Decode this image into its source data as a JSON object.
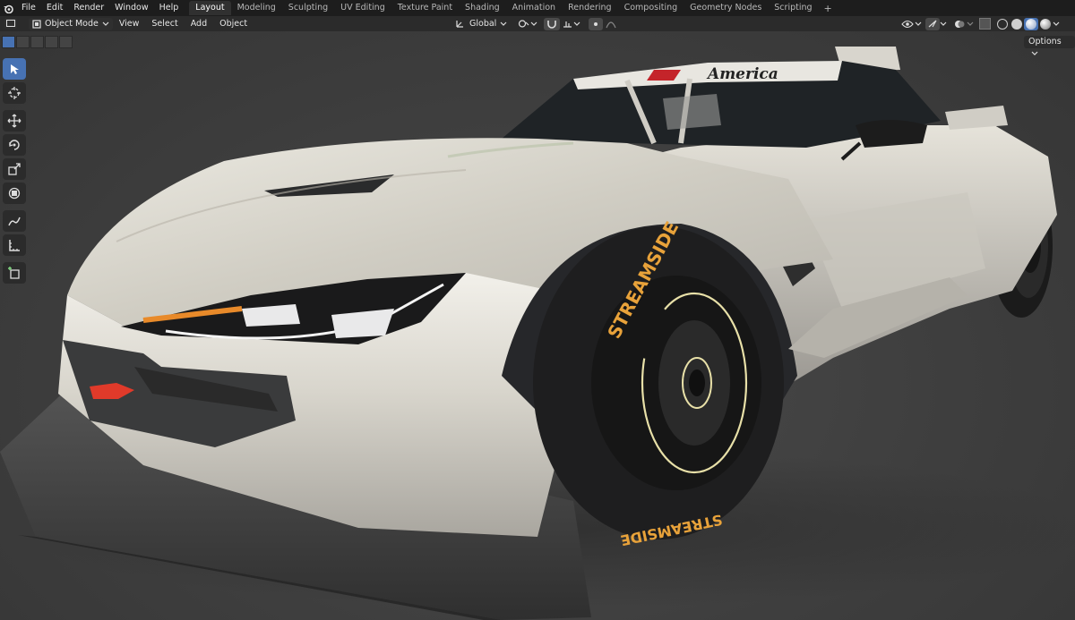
{
  "app": {
    "logo_icon": "blender-logo-icon"
  },
  "menu": [
    "File",
    "Edit",
    "Render",
    "Window",
    "Help"
  ],
  "workspaces": {
    "tabs": [
      "Layout",
      "Modeling",
      "Sculpting",
      "UV Editing",
      "Texture Paint",
      "Shading",
      "Animation",
      "Rendering",
      "Compositing",
      "Geometry Nodes",
      "Scripting"
    ],
    "active": "Layout",
    "add_label": "+"
  },
  "header": {
    "mode": "Object Mode",
    "menus": [
      "View",
      "Select",
      "Add",
      "Object"
    ],
    "orientation": "Global",
    "options_label": "Options"
  },
  "toolbar_tools": [
    "select-box-icon",
    "cursor-icon",
    "move-icon",
    "rotate-icon",
    "scale-icon",
    "transform-icon",
    "annotate-icon",
    "measure-icon",
    "add-cube-icon"
  ],
  "scene": {
    "windshield_banner": "America",
    "tire_brand": "STREAMSIDE"
  },
  "colors": {
    "accent": "#4772b3",
    "topbar": "#1d1d1d",
    "header": "#2b2b2b",
    "viewport": "#3d3d3d",
    "tire_text": "#e8a23a",
    "tow_hook": "#e03a2a"
  }
}
